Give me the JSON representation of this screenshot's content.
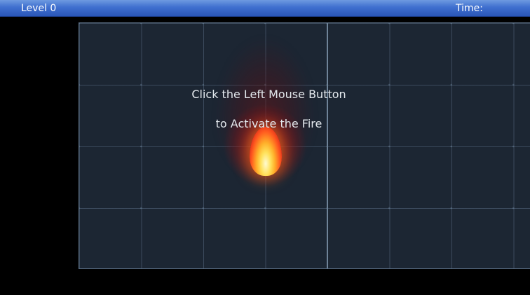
{
  "hud": {
    "level_label": "Level 0",
    "time_label": "Time:",
    "time_value": ""
  },
  "instructions": {
    "line1": "Click the Left Mouse Button",
    "line2": "to Activate the Fire"
  },
  "colors": {
    "hud_bar": "#3f6fcf",
    "arena_background": "#1c2633",
    "arena_border": "#5b6f86",
    "fire_core": "#ffe15a",
    "fire_outer": "#d41818"
  },
  "icons": {
    "fire": "fire-icon"
  }
}
